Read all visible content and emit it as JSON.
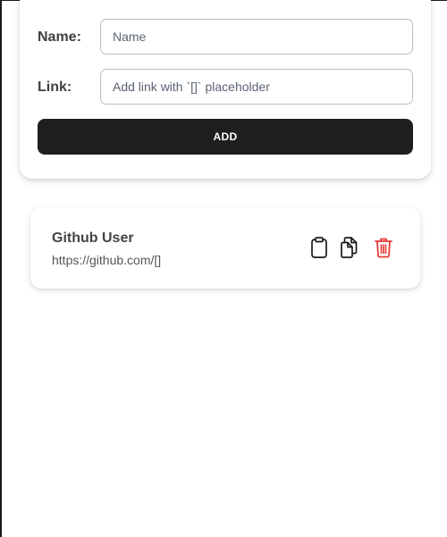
{
  "form": {
    "name_label": "Name:",
    "name_placeholder": "Name",
    "link_label": "Link:",
    "link_placeholder": "Add link with `[]` placeholder",
    "add_label": "ADD"
  },
  "items": [
    {
      "name": "Github User",
      "link": "https://github.com/[]",
      "actions": [
        "clipboard-icon",
        "copy-icon",
        "trash-icon"
      ]
    }
  ],
  "colors": {
    "button_bg": "#1f1f1f",
    "delete_icon": "#e53935"
  }
}
